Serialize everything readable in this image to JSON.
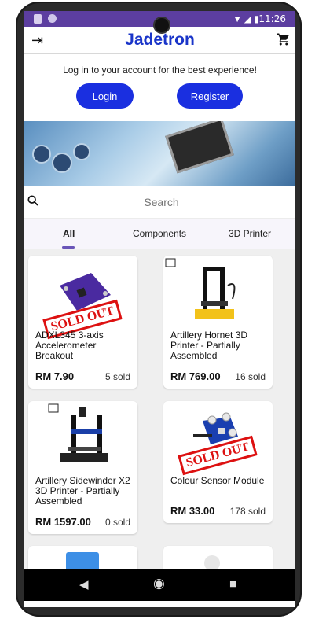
{
  "status_bar": {
    "time": "11:26"
  },
  "header": {
    "title": "Jadetron"
  },
  "auth": {
    "prompt": "Log in to your account for the best experience!",
    "login_label": "Login",
    "register_label": "Register"
  },
  "search": {
    "placeholder": "Search"
  },
  "tabs": [
    {
      "label": "All"
    },
    {
      "label": "Components"
    },
    {
      "label": "3D Printer"
    }
  ],
  "products": [
    {
      "name": "ADXL345 3-axis Accelerometer Breakout",
      "price": "RM 7.90",
      "sold": "5 sold",
      "stamp": "SOLD OUT"
    },
    {
      "name": "Artillery Hornet 3D Printer - Partially Assembled",
      "price": "RM 769.00",
      "sold": "16 sold"
    },
    {
      "name": "Artillery Sidewinder X2 3D Printer - Partially Assembled",
      "price": "RM 1597.00",
      "sold": "0 sold"
    },
    {
      "name": "Colour Sensor Module",
      "price": "RM 33.00",
      "sold": "178 sold",
      "stamp": "SOLD OUT"
    }
  ],
  "colors": {
    "brand": "#1a35c9",
    "button": "#1a2fe0",
    "status_bar": "#5c3ea0",
    "sold_out": "#dd1111"
  }
}
